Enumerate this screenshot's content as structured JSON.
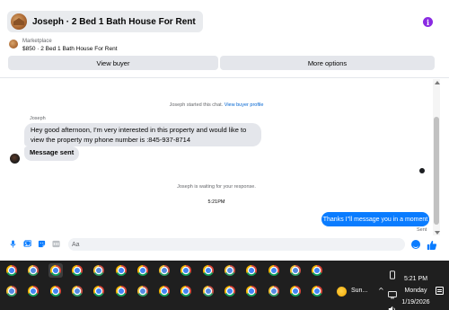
{
  "header": {
    "title": "Joseph · 2 Bed 1 Bath House For Rent",
    "info_icon": "info-icon"
  },
  "marketplace": {
    "label": "Marketplace",
    "listing": "$850 · 2 Bed 1 Bath House For Rent",
    "view_buyer_label": "View buyer",
    "more_options_label": "More options"
  },
  "conversation": {
    "started_text": "Joseph started this chat.",
    "view_profile_link": "View buyer profile",
    "sender_name": "Joseph",
    "incoming_message": "Hey good afternoon, I'm very interested in this property and would like to view the property my phone number is :845-937-8714",
    "message_sent_label": "Message sent",
    "waiting_text": "Joseph is waiting for your response.",
    "timestamp": "5:21PM",
    "outgoing_message": "Thanks I\"ll message you in a moment",
    "sent_status": "Sent"
  },
  "composer": {
    "placeholder": "Aa",
    "value": ""
  },
  "taskbar": {
    "weather_text": "Sun...",
    "clock_time": "5:21 PM",
    "clock_day": "Monday",
    "clock_date": "1/19/2026"
  },
  "colors": {
    "accent": "#0a7cff",
    "info_purple": "#8a2be2",
    "bubble_gray": "#e4e6eb",
    "taskbar_bg": "#1f1f1f"
  }
}
